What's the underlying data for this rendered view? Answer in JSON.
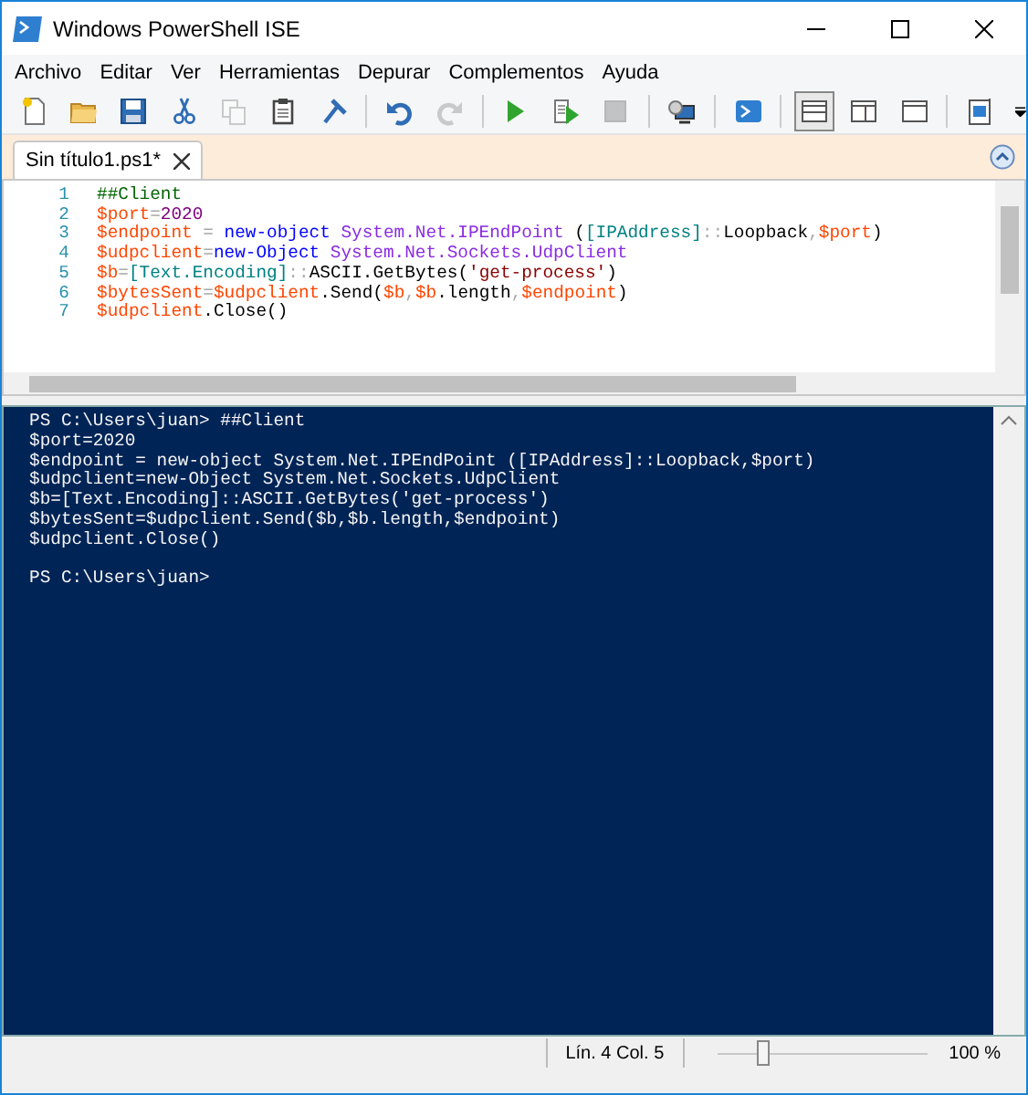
{
  "window": {
    "title": "Windows PowerShell ISE"
  },
  "menu": [
    "Archivo",
    "Editar",
    "Ver",
    "Herramientas",
    "Depurar",
    "Complementos",
    "Ayuda"
  ],
  "toolbar": [
    {
      "kind": "new",
      "disabled": false
    },
    {
      "kind": "open",
      "disabled": false
    },
    {
      "kind": "save",
      "disabled": false
    },
    {
      "kind": "cut",
      "disabled": false
    },
    {
      "kind": "copy",
      "disabled": true
    },
    {
      "kind": "paste",
      "disabled": false
    },
    {
      "kind": "clear",
      "disabled": false
    },
    {
      "kind": "separator"
    },
    {
      "kind": "undo",
      "disabled": false
    },
    {
      "kind": "redo",
      "disabled": true
    },
    {
      "kind": "separator"
    },
    {
      "kind": "run",
      "disabled": false
    },
    {
      "kind": "run-selection",
      "disabled": false
    },
    {
      "kind": "stop",
      "disabled": true
    },
    {
      "kind": "separator"
    },
    {
      "kind": "remote",
      "disabled": false
    },
    {
      "kind": "separator"
    },
    {
      "kind": "console",
      "disabled": false
    },
    {
      "kind": "separator"
    },
    {
      "kind": "layout-top",
      "selected": true
    },
    {
      "kind": "layout-right",
      "selected": false
    },
    {
      "kind": "layout-max",
      "selected": false
    },
    {
      "kind": "separator"
    },
    {
      "kind": "commands",
      "disabled": false
    }
  ],
  "tabs": [
    {
      "label": "Sin título1.ps1*",
      "selected": true
    }
  ],
  "editor": {
    "lines": [
      {
        "number": "1",
        "tokens": [
          {
            "text": "##Client",
            "kind": "comment"
          }
        ]
      },
      {
        "number": "2",
        "tokens": [
          {
            "text": "$port",
            "kind": "variable"
          },
          {
            "text": "=",
            "kind": "operator"
          },
          {
            "text": "2020",
            "kind": "number"
          }
        ]
      },
      {
        "number": "3",
        "tokens": [
          {
            "text": "$endpoint",
            "kind": "variable"
          },
          {
            "text": " = ",
            "kind": "operator"
          },
          {
            "text": "new-object",
            "kind": "command"
          },
          {
            "text": " System.Net.IPEndPoint",
            "kind": "argument"
          },
          {
            "text": " (",
            "kind": "plain"
          },
          {
            "text": "[IPAddress]",
            "kind": "type"
          },
          {
            "text": "::",
            "kind": "operator"
          },
          {
            "text": "Loopback",
            "kind": "plain"
          },
          {
            "text": ",",
            "kind": "operator"
          },
          {
            "text": "$port",
            "kind": "variable"
          },
          {
            "text": ")",
            "kind": "plain"
          }
        ]
      },
      {
        "number": "4",
        "tokens": [
          {
            "text": "$udpclient",
            "kind": "variable"
          },
          {
            "text": "=",
            "kind": "operator"
          },
          {
            "text": "new-Object",
            "kind": "command"
          },
          {
            "text": " System.Net.Sockets.UdpClient",
            "kind": "argument"
          }
        ]
      },
      {
        "number": "5",
        "tokens": [
          {
            "text": "$b",
            "kind": "variable"
          },
          {
            "text": "=",
            "kind": "operator"
          },
          {
            "text": "[Text.Encoding]",
            "kind": "type"
          },
          {
            "text": "::",
            "kind": "operator"
          },
          {
            "text": "ASCII.GetBytes(",
            "kind": "plain"
          },
          {
            "text": "'get-process'",
            "kind": "string"
          },
          {
            "text": ")",
            "kind": "plain"
          }
        ]
      },
      {
        "number": "6",
        "tokens": [
          {
            "text": "$bytesSent",
            "kind": "variable"
          },
          {
            "text": "=",
            "kind": "operator"
          },
          {
            "text": "$udpclient",
            "kind": "variable"
          },
          {
            "text": ".Send(",
            "kind": "plain"
          },
          {
            "text": "$b",
            "kind": "variable"
          },
          {
            "text": ",",
            "kind": "operator"
          },
          {
            "text": "$b",
            "kind": "variable"
          },
          {
            "text": ".length",
            "kind": "plain"
          },
          {
            "text": ",",
            "kind": "operator"
          },
          {
            "text": "$endpoint",
            "kind": "variable"
          },
          {
            "text": ")",
            "kind": "plain"
          }
        ]
      },
      {
        "number": "7",
        "tokens": [
          {
            "text": "$udpclient",
            "kind": "variable"
          },
          {
            "text": ".Close()",
            "kind": "plain"
          }
        ]
      }
    ]
  },
  "console": {
    "blocks": [
      [
        "PS C:\\Users\\juan> ##Client",
        "$port=2020",
        "$endpoint = new-object System.Net.IPEndPoint ([IPAddress]::Loopback,$port)",
        "$udpclient=new-Object System.Net.Sockets.UdpClient",
        "$b=[Text.Encoding]::ASCII.GetBytes('get-process')",
        "$bytesSent=$udpclient.Send($b,$b.length,$endpoint)",
        "$udpclient.Close()"
      ],
      [
        "PS C:\\Users\\juan>"
      ]
    ]
  },
  "status_bar": {
    "position": "Lín. 4 Col. 5",
    "zoom": {
      "level": 0.22
    },
    "zoom_reading": "100 %"
  }
}
